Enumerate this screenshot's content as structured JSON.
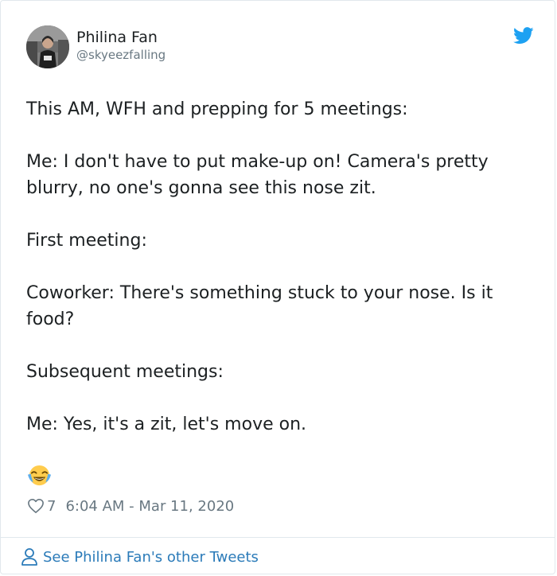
{
  "user": {
    "name": "Philina Fan",
    "handle": "@skyeezfalling"
  },
  "tweet": {
    "paragraphs": [
      "This AM, WFH and prepping for 5 meetings:",
      "Me: I don't have to put make-up on! Camera's pretty blurry, no one's gonna see this nose zit.",
      "First meeting:",
      "Coworker: There's something stuck to your nose. Is it food?",
      "Subsequent meetings:",
      "Me: Yes, it's a zit, let's move on."
    ],
    "emoji": "face-with-tears-of-joy"
  },
  "meta": {
    "likes": "7",
    "timestamp": "6:04 AM - Mar 11, 2020"
  },
  "footer": {
    "link_label": "See Philina Fan's other Tweets"
  },
  "colors": {
    "link": "#2b7bb9",
    "twitter_blue": "#1da1f2",
    "muted": "#697882",
    "text": "#1c2022",
    "border": "#e1e8ed"
  },
  "icons": {
    "brand": "twitter-bird-icon",
    "like": "heart-icon",
    "footer": "person-icon"
  }
}
